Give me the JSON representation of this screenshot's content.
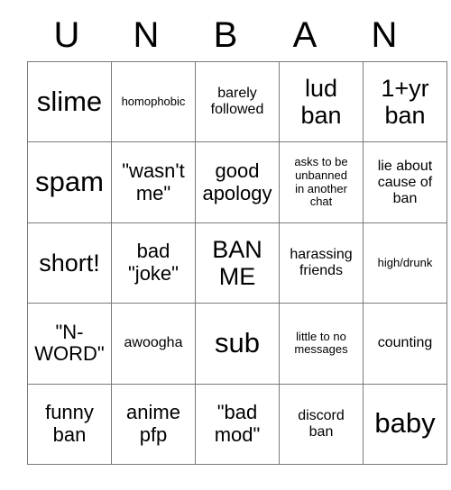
{
  "card": {
    "title_letters": [
      "U",
      "N",
      "B",
      "A",
      "N"
    ],
    "border_color": "#7a7a7a",
    "text_color": "#000000",
    "background_color": "#ffffff",
    "rows": [
      [
        {
          "text": "slime",
          "size": "xl"
        },
        {
          "text": "homophobic",
          "size": "xs"
        },
        {
          "text": "barely\nfollowed",
          "size": "sm"
        },
        {
          "text": "lud\nban",
          "size": "lg"
        },
        {
          "text": "1+yr\nban",
          "size": "lg"
        }
      ],
      [
        {
          "text": "spam",
          "size": "xl"
        },
        {
          "text": "\"wasn't\nme\"",
          "size": "md"
        },
        {
          "text": "good\napology",
          "size": "md"
        },
        {
          "text": "asks to be\nunbanned\nin another\nchat",
          "size": "xs"
        },
        {
          "text": "lie about\ncause of\nban",
          "size": "sm"
        }
      ],
      [
        {
          "text": "short!",
          "size": "lg"
        },
        {
          "text": "bad\n\"joke\"",
          "size": "md"
        },
        {
          "text": "BAN\nME",
          "size": "lg"
        },
        {
          "text": "harassing\nfriends",
          "size": "sm"
        },
        {
          "text": "high/drunk",
          "size": "xs"
        }
      ],
      [
        {
          "text": "\"N-\nWORD\"",
          "size": "md"
        },
        {
          "text": "awoogha",
          "size": "sm"
        },
        {
          "text": "sub",
          "size": "xl"
        },
        {
          "text": "little to no\nmessages",
          "size": "xs"
        },
        {
          "text": "counting",
          "size": "sm"
        }
      ],
      [
        {
          "text": "funny\nban",
          "size": "md"
        },
        {
          "text": "anime\npfp",
          "size": "md"
        },
        {
          "text": "\"bad\nmod\"",
          "size": "md"
        },
        {
          "text": "discord\nban",
          "size": "sm"
        },
        {
          "text": "baby",
          "size": "xl"
        }
      ]
    ]
  }
}
